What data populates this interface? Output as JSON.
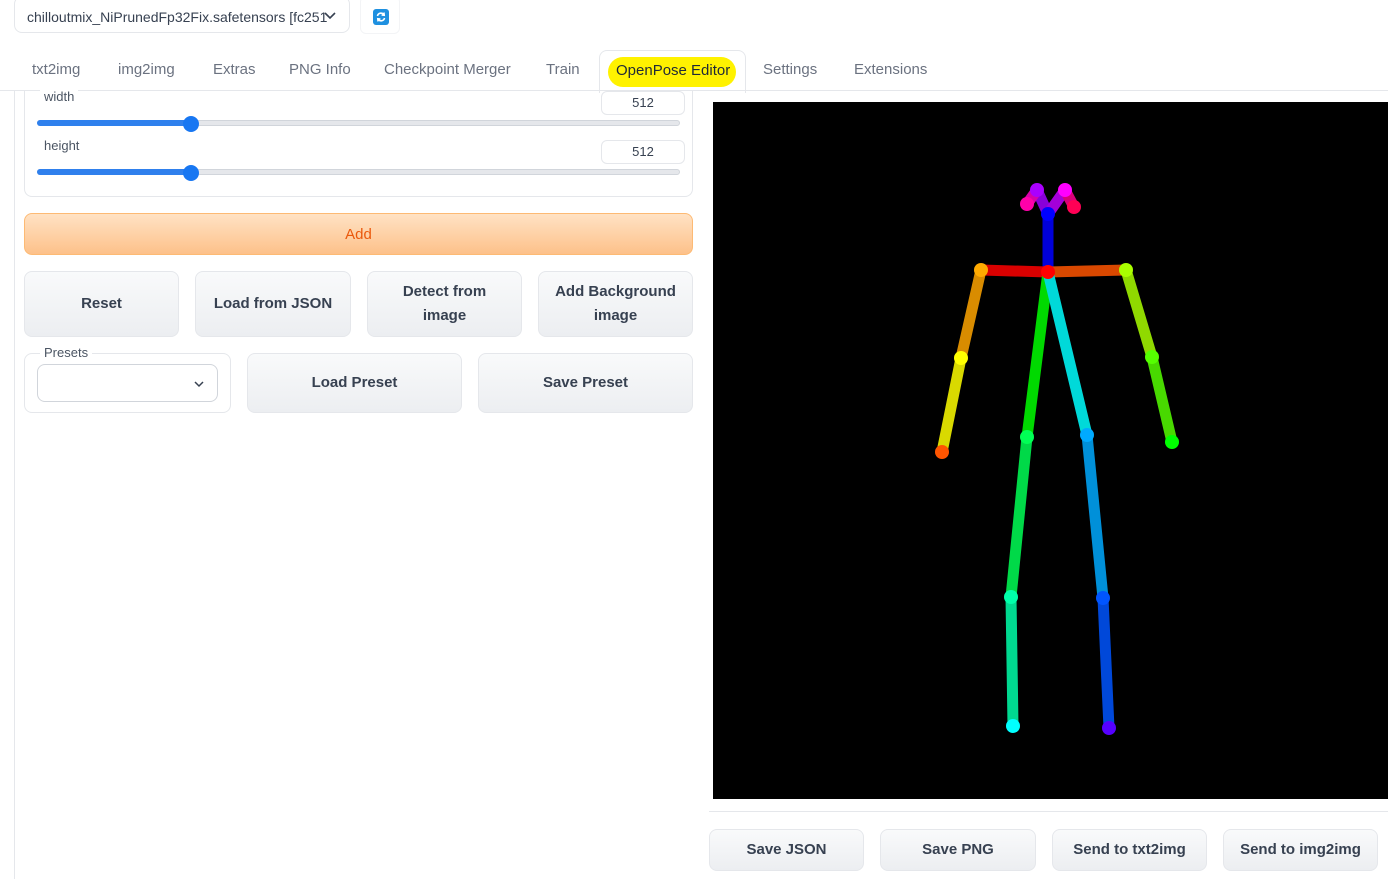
{
  "model": {
    "selected": "chilloutmix_NiPrunedFp32Fix.safetensors [fc251"
  },
  "tabs": [
    {
      "label": "txt2img"
    },
    {
      "label": "img2img"
    },
    {
      "label": "Extras"
    },
    {
      "label": "PNG Info"
    },
    {
      "label": "Checkpoint Merger"
    },
    {
      "label": "Train"
    },
    {
      "label": "OpenPose Editor"
    },
    {
      "label": "Settings"
    },
    {
      "label": "Extensions"
    }
  ],
  "active_tab": "OpenPose Editor",
  "width": {
    "label": "width",
    "value": "512",
    "fraction": 0.24
  },
  "height": {
    "label": "height",
    "value": "512",
    "fraction": 0.24
  },
  "buttons": {
    "add": "Add",
    "reset": "Reset",
    "load_json": "Load from JSON",
    "detect_line1": "Detect from",
    "detect_line2": "image",
    "add_bg_line1": "Add Background",
    "add_bg_line2": "image",
    "load_preset": "Load Preset",
    "save_preset": "Save Preset",
    "save_json": "Save JSON",
    "save_png": "Save PNG",
    "send_txt2img": "Send to txt2img",
    "send_img2img": "Send to img2img"
  },
  "presets": {
    "label": "Presets",
    "value": ""
  },
  "colors": {
    "accent": "#1877f2",
    "add_text": "#ea580c",
    "highlight": "#fff200",
    "canvas": "#000000"
  },
  "icons": {
    "refresh": "refresh-icon",
    "dropdown": "chevron-down-icon"
  }
}
